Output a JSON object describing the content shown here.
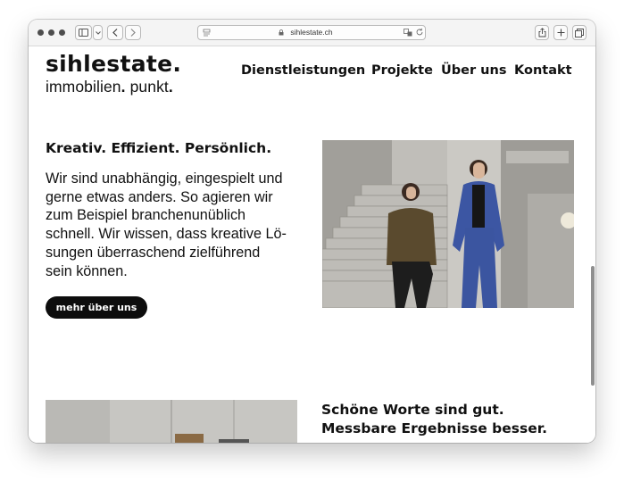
{
  "browser": {
    "url": "sihlestate.ch",
    "sidebar_icon": "sidebar-icon",
    "back_icon": "chevron-left-icon",
    "forward_icon": "chevron-right-icon",
    "share_icon": "share-icon",
    "new_tab_icon": "plus-icon",
    "tabs_icon": "tabs-icon"
  },
  "logo": {
    "main": "sihlestate.",
    "sub_1": "immobilien",
    "sub_dot_1": ".",
    "sub_2": " punkt",
    "sub_dot_2": "."
  },
  "nav": {
    "items": [
      {
        "label": "Dienstleistungen"
      },
      {
        "label": "Projekte"
      },
      {
        "label": "Über uns"
      },
      {
        "label": "Kontakt"
      }
    ]
  },
  "section1": {
    "heading": "Kreativ. Effizient. Persönlich.",
    "paragraph_lines": [
      "Wir sind unabhängig, eingespielt und",
      "gerne etwas anders. So agieren wir",
      "zum Beispiel branchenunüblich",
      "schnell. Wir wissen, dass kreative Lö-",
      "sungen überraschend zielführend",
      "sein können."
    ],
    "cta": "mehr über uns"
  },
  "section2": {
    "heading_lines": [
      "Schöne Worte sind gut.",
      "Messbare Ergebnisse besser."
    ]
  },
  "colors": {
    "text": "#111111",
    "button_bg": "#0d0d0d",
    "button_text": "#ffffff",
    "chrome_bg": "#f4f4f4"
  }
}
